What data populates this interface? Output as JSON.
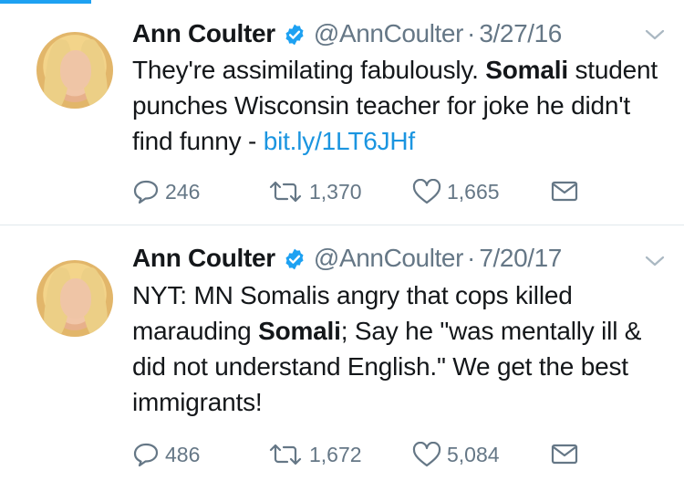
{
  "tweets": [
    {
      "author_name": "Ann Coulter",
      "handle": "@AnnCoulter",
      "separator": "·",
      "date": "3/27/16",
      "text_before": "They're assimilating fabulously.  ",
      "text_bold": "Somali",
      "text_after": " student punches Wisconsin teacher for joke he didn't find funny - ",
      "link": "bit.ly/1LT6JHf",
      "replies": "246",
      "retweets": "1,370",
      "likes": "1,665"
    },
    {
      "author_name": "Ann Coulter",
      "handle": "@AnnCoulter",
      "separator": "·",
      "date": "7/20/17",
      "text_before": "NYT: MN Somalis angry that cops killed marauding ",
      "text_bold": "Somali",
      "text_after": "; Say he \"was mentally ill & did not understand English.\" We get the best immigrants!",
      "replies": "486",
      "retweets": "1,672",
      "likes": "5,084"
    }
  ],
  "colors": {
    "accent": "#1da1f2",
    "link": "#1b95e0",
    "muted": "#657786",
    "divider": "#e1e8ed"
  },
  "icons": [
    "verified-badge-icon",
    "chevron-down-icon",
    "reply-icon",
    "retweet-icon",
    "like-icon",
    "direct-message-icon"
  ]
}
